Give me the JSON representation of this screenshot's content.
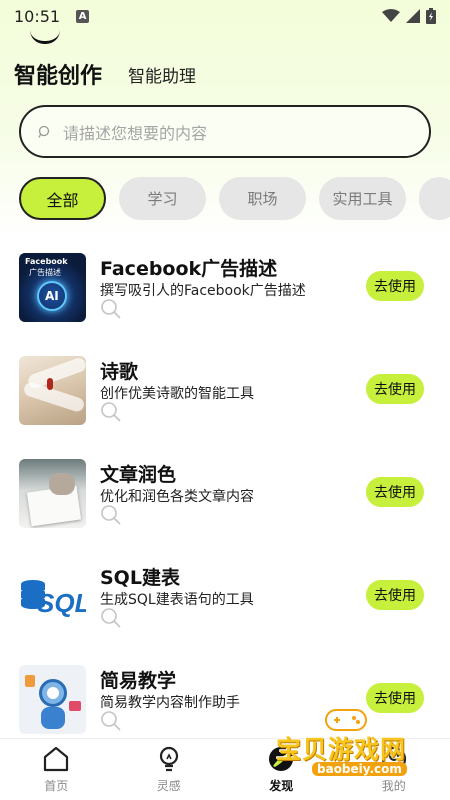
{
  "status_bar": {
    "time": "10:51",
    "notification_badge": "A"
  },
  "header": {
    "tab_active": "智能创作",
    "tab_other": "智能助理"
  },
  "search": {
    "placeholder": "请描述您想要的内容"
  },
  "categories": [
    "全部",
    "学习",
    "职场",
    "实用工具"
  ],
  "items": [
    {
      "title": "Facebook广告描述",
      "desc": "撰写吸引人的Facebook广告描述",
      "button": "去使用",
      "thumb_text_1": "Facebook",
      "thumb_text_2": "广告描述",
      "thumb_text_3": "AI"
    },
    {
      "title": "诗歌",
      "desc": "创作优美诗歌的智能工具",
      "button": "去使用"
    },
    {
      "title": "文章润色",
      "desc": "优化和润色各类文章内容",
      "button": "去使用"
    },
    {
      "title": "SQL建表",
      "desc": "生成SQL建表语句的工具",
      "button": "去使用",
      "thumb_text_1": "SQL"
    },
    {
      "title": "简易教学",
      "desc": "简易教学内容制作助手",
      "button": "去使用"
    }
  ],
  "bottom_nav": [
    {
      "label": "首页",
      "icon": "home-icon"
    },
    {
      "label": "灵感",
      "icon": "lightbulb-icon"
    },
    {
      "label": "发现",
      "icon": "discover-icon"
    },
    {
      "label": "我的",
      "icon": "profile-icon"
    }
  ],
  "watermark": {
    "text": "宝贝游戏网",
    "url": "baobeiy.com"
  },
  "colors": {
    "accent": "#c6f03c",
    "chip_bg": "#e6e6e6",
    "header_bg": "#f3fdd9"
  }
}
